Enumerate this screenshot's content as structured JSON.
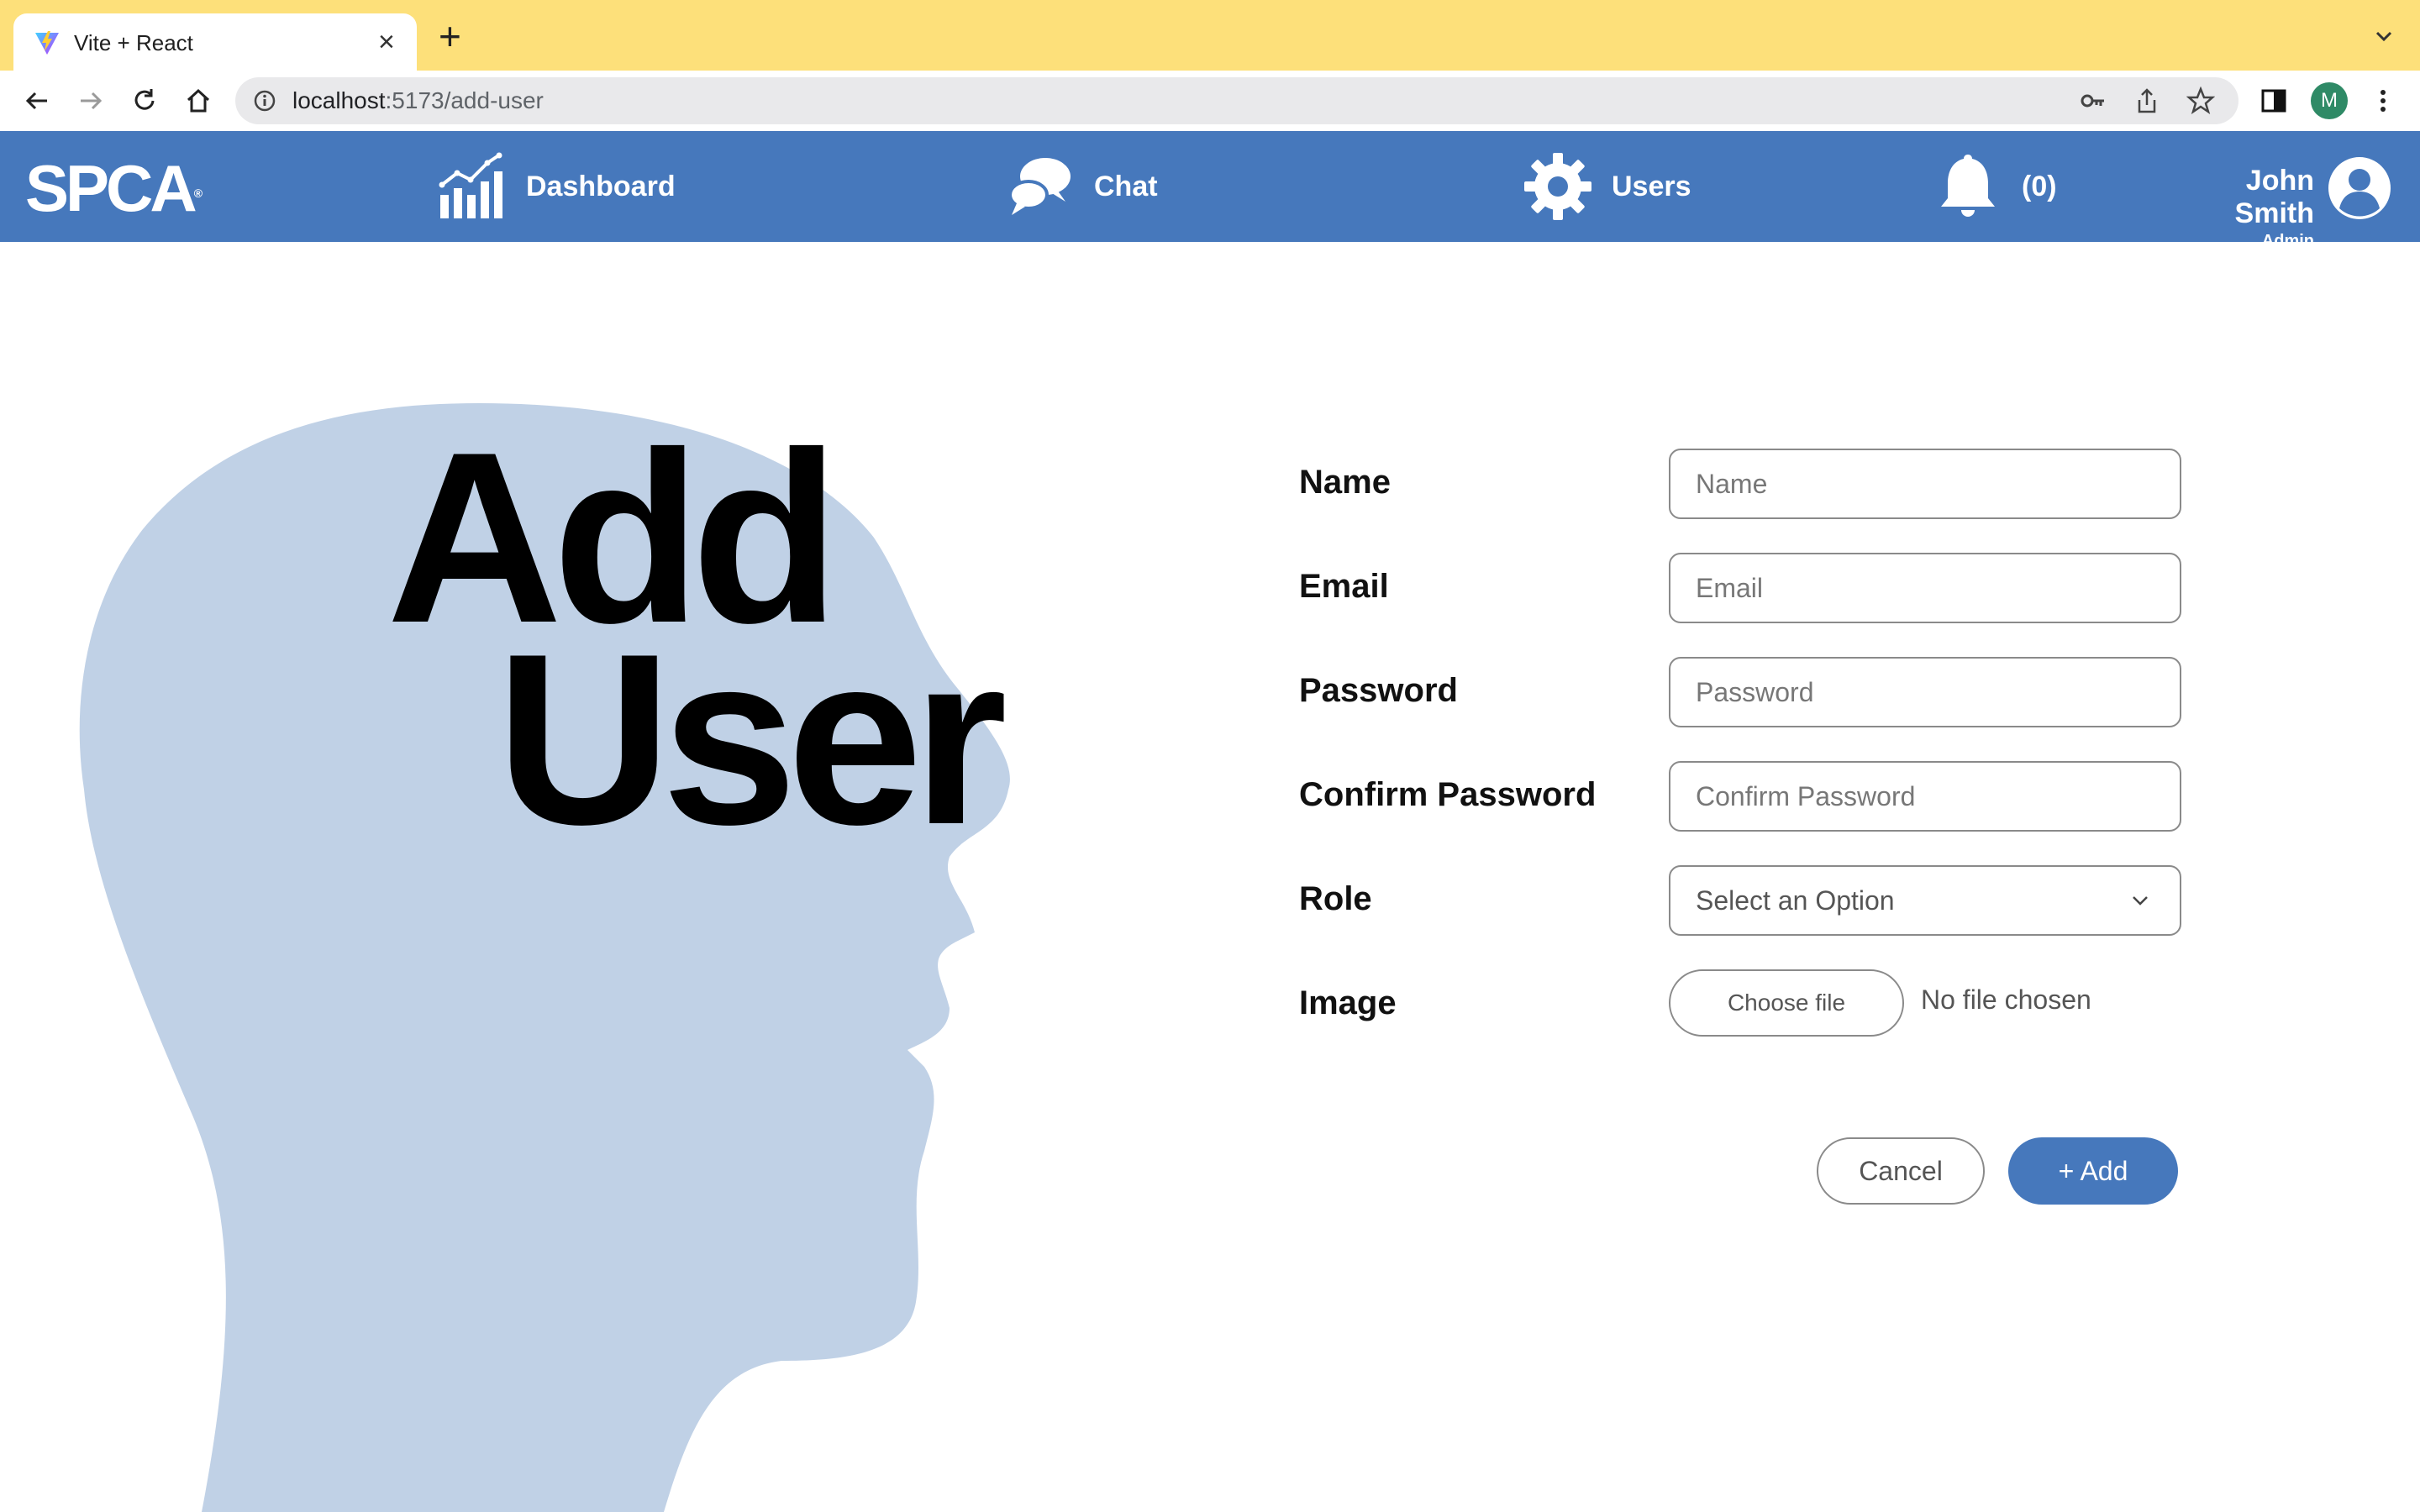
{
  "browser": {
    "tab_title": "Vite + React",
    "tab_close": "×",
    "new_tab": "+",
    "url_host": "localhost",
    "url_path": ":5173/add-user",
    "profile_initial": "M"
  },
  "nav": {
    "logo": "SPCA",
    "logo_mark": "®",
    "items": [
      {
        "label": "Dashboard",
        "icon": "chart-icon"
      },
      {
        "label": "Chat",
        "icon": "chat-bubbles-icon"
      },
      {
        "label": "Users",
        "icon": "gear-icon"
      }
    ],
    "notifications": {
      "label": "(0)",
      "icon": "bell-icon"
    },
    "user": {
      "name": "John Smith",
      "role": "Admin"
    }
  },
  "hero": {
    "line1": "Add",
    "line2": "User"
  },
  "form": {
    "fields": [
      {
        "label": "Name",
        "placeholder": "Name"
      },
      {
        "label": "Email",
        "placeholder": "Email"
      },
      {
        "label": "Password",
        "placeholder": "Password"
      },
      {
        "label": "Confirm Password",
        "placeholder": "Confirm Password"
      }
    ],
    "role": {
      "label": "Role",
      "value": "Select an Option"
    },
    "image": {
      "label": "Image",
      "button": "Choose file",
      "status": "No file chosen"
    },
    "cancel": "Cancel",
    "add": "+ Add"
  },
  "colors": {
    "brand_blue": "#4678bc",
    "tab_strip": "#fde07a",
    "silhouette": "#c0d1e6"
  }
}
